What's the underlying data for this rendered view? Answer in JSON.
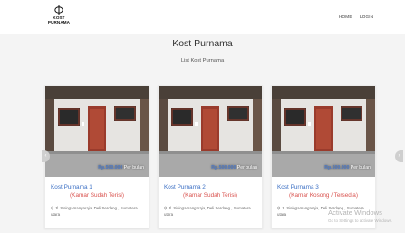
{
  "header": {
    "logo_text_line1": "KOST",
    "logo_text_line2": "PURNAMA",
    "nav": [
      {
        "label": "HOME"
      },
      {
        "label": "LOGIN"
      }
    ]
  },
  "page": {
    "title": "Kost Purnama",
    "subtitle": "List Kost Purnama"
  },
  "cards": [
    {
      "name": "Kost Purnama 1",
      "status": "(Kamar Sudah Terisi)",
      "price_amount": "Rp.500.000",
      "price_unit": "Per bulan",
      "address_street": "Jl. Sisingamangaraja",
      "address_rest": ", Deli Serdang , Sumatera utara"
    },
    {
      "name": "Kost Purnama 2",
      "status": "(Kamar Sudah Terisi)",
      "price_amount": "Rp.500.000",
      "price_unit": "Per bulan",
      "address_street": "Jl. Sisingamangaraja",
      "address_rest": ", Deli Serdang , Sumatera utara"
    },
    {
      "name": "Kost Purnama 3",
      "status": "(Kamar Kosong / Tersedia)",
      "price_amount": "Rp.500.000",
      "price_unit": "Per bulan",
      "address_street": "Jl. Sisingamangaraja",
      "address_rest": ", Deli Serdang , Sumatera utara"
    }
  ],
  "carousel": {
    "prev_icon": "chevron-left-icon",
    "next_icon": "chevron-right-icon"
  },
  "watermark": {
    "line1": "Activate Windows",
    "line2": "Go to Settings to activate Windows."
  },
  "colors": {
    "link_blue": "#3b6fc4",
    "status_red": "#d9534f",
    "price_blue": "#4a78c9"
  }
}
